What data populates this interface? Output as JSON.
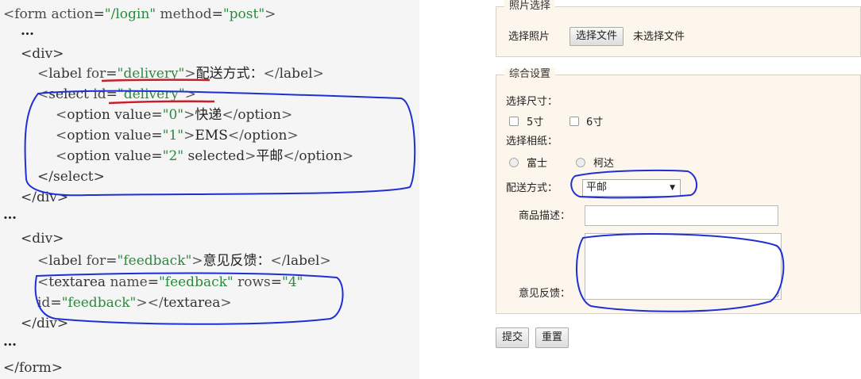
{
  "code": {
    "form_open": {
      "tag": "form",
      "attr1": "action",
      "val1": "\"/login\"",
      "attr2": "method",
      "val2": "\"post\""
    },
    "ellipsis": "…",
    "div_open": "<div>",
    "div_close": "</div>",
    "label_delivery": {
      "attr": "for",
      "val": "\"delivery\"",
      "text": "配送方式："
    },
    "select_open": {
      "attr": "id",
      "val": "\"delivery\""
    },
    "options": [
      {
        "val": "\"0\"",
        "text": "快递"
      },
      {
        "val": "\"1\"",
        "text": "EMS"
      },
      {
        "val": "\"2\"",
        "extra": "selected",
        "text": "平邮"
      }
    ],
    "select_close": "</select>",
    "label_feedback": {
      "attr": "for",
      "val": "\"feedback\"",
      "text": "意见反馈："
    },
    "textarea_line1": {
      "attr1": "name",
      "val1": "\"feedback\"",
      "attr2": "rows",
      "val2": "\"4\""
    },
    "textarea_line2": {
      "attr": "id",
      "val": "\"feedback\""
    },
    "form_close": "</form>"
  },
  "form": {
    "photo_section": {
      "legend": "照片选择",
      "label": "选择照片",
      "file_button": "选择文件",
      "file_status": "未选择文件"
    },
    "settings_section": {
      "legend": "综合设置",
      "size_label": "选择尺寸：",
      "size_options": [
        "5寸",
        "6寸"
      ],
      "paper_label": "选择相纸：",
      "paper_options": [
        "富士",
        "柯达"
      ],
      "delivery_label": "配送方式：",
      "delivery_value": "平邮",
      "product_label": "商品描述：",
      "product_value": "",
      "feedback_label": "意见反馈：",
      "feedback_value": ""
    },
    "submit_label": "提交",
    "reset_label": "重置"
  },
  "colors": {
    "annotation_blue": "#1f2fd6",
    "annotation_red": "#c8202a",
    "code_value_green": "#2b8a3e",
    "panel_bg": "#fdf6ec"
  },
  "icons": {
    "dropdown": "triangle-down-icon",
    "resize": "resize-grip-icon"
  }
}
